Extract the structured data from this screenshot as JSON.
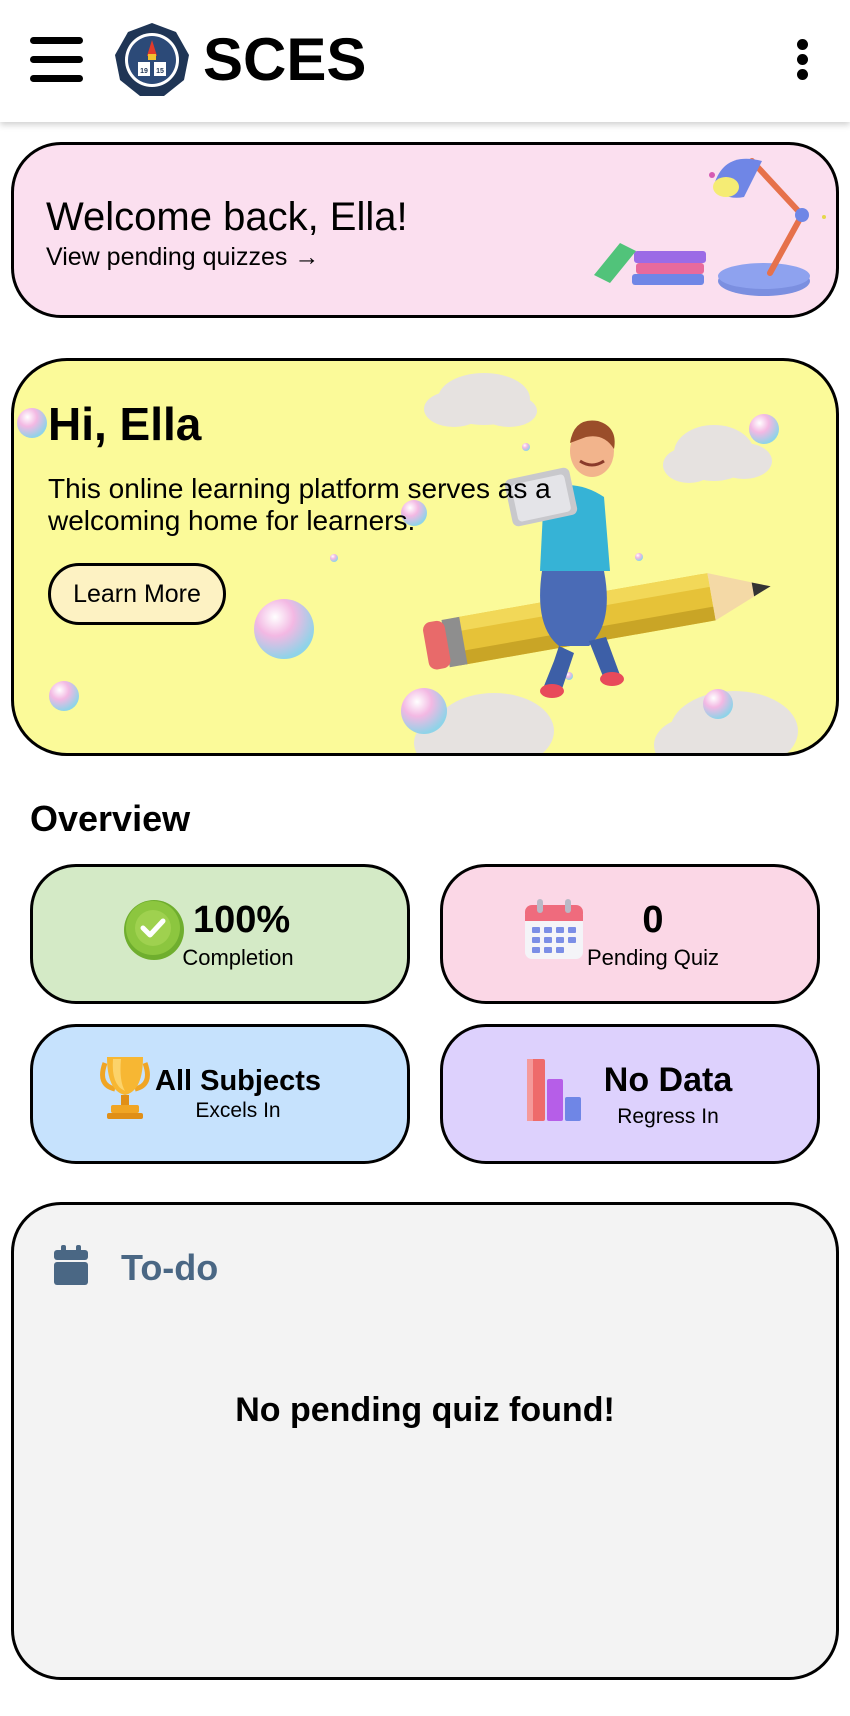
{
  "header": {
    "app_title": "SCES",
    "logo_ring_text": "STA. CLARA ELEMENTARY SCHOOL",
    "logo_city_text": "BATANGAS CITY",
    "logo_year_left": "19",
    "logo_year_right": "15"
  },
  "welcome": {
    "greeting": "Welcome back, Ella!",
    "link_label": "View pending quizzes →"
  },
  "hero": {
    "title": "Hi, Ella",
    "description": "This online learning platform serves as a welcoming home for learners.",
    "button_label": "Learn More"
  },
  "overview": {
    "title": "Overview",
    "stats": [
      {
        "value": "100%",
        "label": "Completion",
        "icon": "check-badge-icon",
        "color": "#d4eac6"
      },
      {
        "value": "0",
        "label": "Pending Quiz",
        "icon": "calendar-icon",
        "color": "#fbd7e6"
      },
      {
        "value": "All Subjects",
        "label": "Excels In",
        "icon": "trophy-icon",
        "color": "#c6e2fd"
      },
      {
        "value": "No Data",
        "label": "Regress In",
        "icon": "bar-chart-icon",
        "color": "#ddd1fd"
      }
    ]
  },
  "todo": {
    "title": "To-do",
    "empty_message": "No pending quiz found!"
  },
  "colors": {
    "welcome_bg": "#fbdfef",
    "hero_bg": "#fbfa99",
    "todo_bg": "#f3f3f3",
    "todo_accent": "#4a6784"
  }
}
